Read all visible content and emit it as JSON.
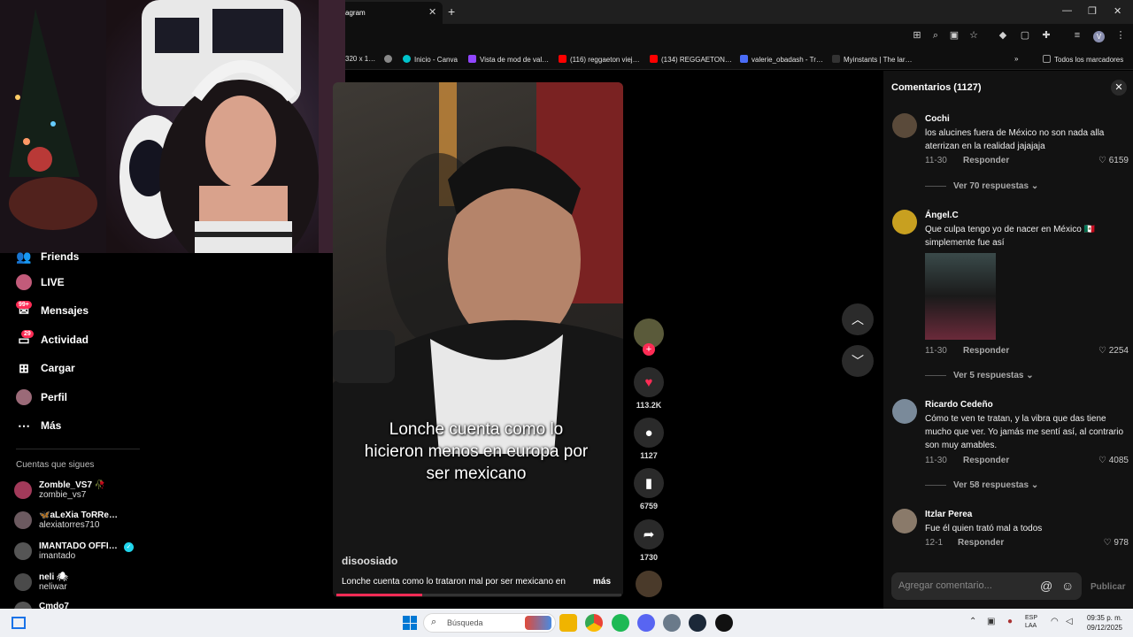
{
  "browser": {
    "active_tab_title": "agram",
    "bookmarks": [
      "320 x 1…",
      "Inicio - Canva",
      "Vista de mod de val…",
      "(116) reggaeton viej…",
      "(134) REGGAETON…",
      "valerie_obadash - Tr…",
      "Myinstants | The lar…",
      "Todos los marcadores"
    ],
    "bookmark_colors": [
      "#888888",
      "#00c4cc",
      "#9146ff",
      "#ff0000",
      "#ff0000",
      "#4a6cf7",
      "#222222",
      "#999999"
    ]
  },
  "sidebar": {
    "items": [
      {
        "label": "Friends",
        "icon": "friends-icon"
      },
      {
        "label": "LIVE",
        "icon": "live-icon"
      },
      {
        "label": "Mensajes",
        "icon": "messages-icon",
        "badge": "99+"
      },
      {
        "label": "Actividad",
        "icon": "activity-icon",
        "badge": "29"
      },
      {
        "label": "Cargar",
        "icon": "upload-icon"
      },
      {
        "label": "Perfil",
        "icon": "profile-icon"
      },
      {
        "label": "Más",
        "icon": "more-icon"
      }
    ],
    "following_title": "Cuentas que sigues",
    "following": [
      {
        "name": "Zomble_VS7 🥀",
        "handle": "zombie_vs7"
      },
      {
        "name": "🦋aLeXia ToRRe…",
        "handle": "alexiatorres710"
      },
      {
        "name": "IMANTADO OFFI…",
        "handle": "imantado"
      },
      {
        "name": "neli 🕷",
        "handle": "neliwar"
      },
      {
        "name": "Cmdo7",
        "handle": ""
      }
    ]
  },
  "video": {
    "overlay_caption": "Lonche cuenta como lo hicieron menos en europa por ser mexicano",
    "author": "disoosiado",
    "description": "Lonche cuenta como lo trataron mal por ser mexicano en",
    "more_label": "más",
    "progress": 0.3,
    "likes": "113.2K",
    "comments": "1127",
    "saves": "6759",
    "shares": "1730"
  },
  "comments": {
    "title": "Comentarios (1127)",
    "reply_label": "Responder",
    "items": [
      {
        "user": "Cochi",
        "text": "los alucines fuera de México no son nada alla aterrizan en la realidad jajajaja",
        "date": "11-30",
        "likes": "6159",
        "more": "Ver 70 respuestas"
      },
      {
        "user": "Ángel.C",
        "text": "Que culpa tengo yo de nacer en México 🇲🇽 simplemente fue así",
        "date": "11-30",
        "likes": "2254",
        "more": "Ver 5 respuestas"
      },
      {
        "user": "Ricardo Cedeño",
        "text": "Cómo te ven te tratan, y la vibra que das tiene mucho que ver. Yo jamás me sentí así, al contrario son muy amables.",
        "date": "11-30",
        "likes": "4085",
        "more": "Ver 58 respuestas"
      },
      {
        "user": "Itzlar Perea",
        "text": "Fue él quien trató mal a todos",
        "date": "12-1",
        "likes": "978",
        "more": ""
      }
    ],
    "input_placeholder": "Agregar comentario...",
    "publish_label": "Publicar"
  },
  "taskbar": {
    "search_placeholder": "Búsqueda",
    "lang_top": "ESP",
    "lang_bottom": "LAA",
    "time": "09:35 p. m.",
    "date": "09/12/2025"
  }
}
